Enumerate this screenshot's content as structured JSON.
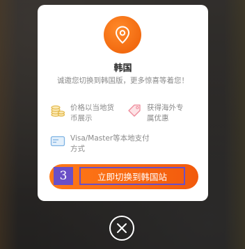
{
  "modal": {
    "title": "韩国",
    "subtitle": "诚邀您切换到韩国版，更多惊喜等着您！",
    "features": [
      {
        "icon": "coins-icon",
        "text": "价格以当地货\n币展示"
      },
      {
        "icon": "price-tag-icon",
        "text": "获得海外专\n属优惠"
      },
      {
        "icon": "card-icon",
        "text": "Visa/Master等本地支付\n方式"
      }
    ],
    "cta_label": "立即切换到韩国站",
    "step_number": "3"
  },
  "colors": {
    "accent": "#f26a10",
    "annotation": "#6a4fc7"
  }
}
